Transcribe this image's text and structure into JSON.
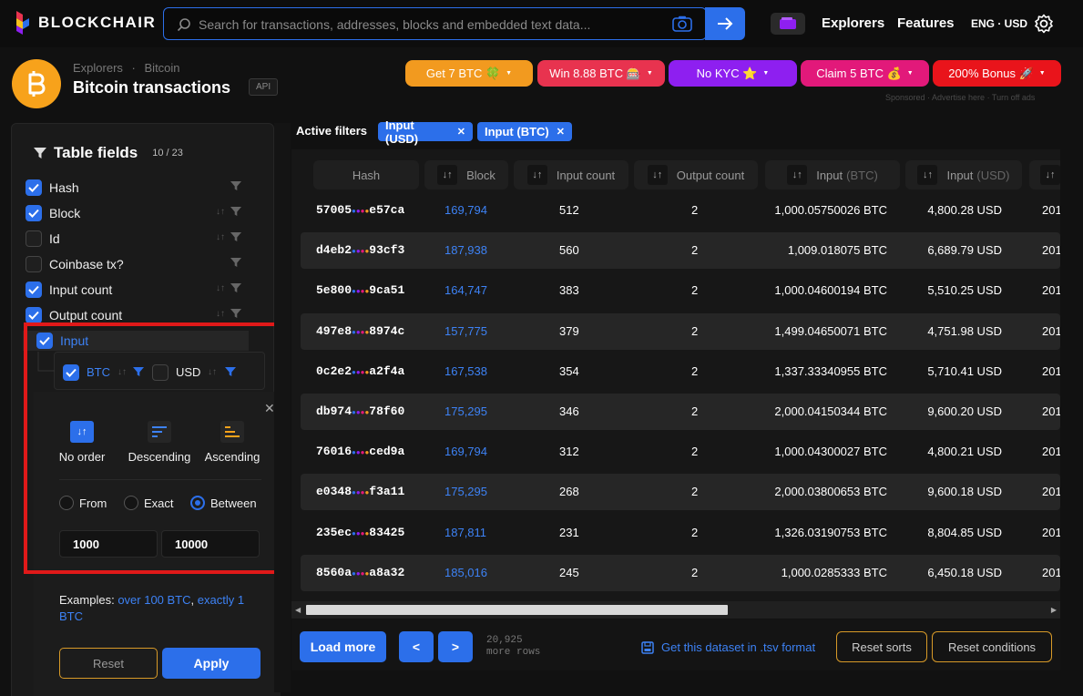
{
  "header": {
    "brand": "BLOCKCHAIR",
    "search_placeholder": "Search for transactions, addresses, blocks and embedded text data...",
    "nav": [
      "Explorers",
      "Features"
    ],
    "lang_currency": "ENG · USD"
  },
  "title": {
    "breadcrumb": [
      "Explorers",
      "Bitcoin"
    ],
    "page_title": "Bitcoin transactions",
    "api_badge": "API"
  },
  "promos": [
    {
      "label": "Get 7 BTC 🍀",
      "color": "#f29a1f"
    },
    {
      "label": "Win 8.88 BTC 🎰",
      "color": "#e8334f"
    },
    {
      "label": "No KYC ⭐",
      "color": "#8e1ff0"
    },
    {
      "label": "Claim 5 BTC 💰",
      "color": "#e2197a"
    },
    {
      "label": "200% Bonus 🚀",
      "color": "#e9141b"
    }
  ],
  "sponsored": "Sponsored · Advertise here · Turn off ads",
  "sidebar": {
    "title": "Table fields",
    "count": "10 / 23",
    "fields": [
      {
        "name": "Hash",
        "checked": true,
        "sort": false
      },
      {
        "name": "Block",
        "checked": true,
        "sort": true
      },
      {
        "name": "Id",
        "checked": false,
        "sort": true
      },
      {
        "name": "Coinbase tx?",
        "checked": false,
        "sort": false
      },
      {
        "name": "Input count",
        "checked": true,
        "sort": true
      },
      {
        "name": "Output count",
        "checked": true,
        "sort": true
      },
      {
        "name": "Input",
        "checked": true,
        "sort": false
      }
    ],
    "subfields": [
      {
        "name": "BTC",
        "checked": true
      },
      {
        "name": "USD",
        "checked": false
      }
    ],
    "order_options": [
      "No order",
      "Descending",
      "Ascending"
    ],
    "range_options": [
      "From",
      "Exact",
      "Between"
    ],
    "range_selected": "Between",
    "range_from": "1000",
    "range_to": "10000",
    "examples_prefix": "Examples: ",
    "example_1": "over 100 BTC",
    "example_sep": ", ",
    "example_2": "exactly 1 BTC",
    "reset_label": "Reset",
    "apply_label": "Apply"
  },
  "filters": {
    "label": "Active filters",
    "chips": [
      "Input (USD)",
      "Input (BTC)"
    ]
  },
  "table": {
    "columns": [
      "Hash",
      "Block",
      "Input count",
      "Output count",
      "Input",
      "(BTC)",
      "Input",
      "(USD)"
    ],
    "rows": [
      {
        "hash_a": "57005",
        "hash_b": "e57ca",
        "block": "169,794",
        "in_count": "512",
        "out_count": "2",
        "in_btc": "1,000.05750026 BTC",
        "in_usd": "4,800.28 USD",
        "date": "201"
      },
      {
        "hash_a": "d4eb2",
        "hash_b": "93cf3",
        "block": "187,938",
        "in_count": "560",
        "out_count": "2",
        "in_btc": "1,009.018075 BTC",
        "in_usd": "6,689.79 USD",
        "date": "201"
      },
      {
        "hash_a": "5e800",
        "hash_b": "9ca51",
        "block": "164,747",
        "in_count": "383",
        "out_count": "2",
        "in_btc": "1,000.04600194 BTC",
        "in_usd": "5,510.25 USD",
        "date": "201"
      },
      {
        "hash_a": "497e8",
        "hash_b": "8974c",
        "block": "157,775",
        "in_count": "379",
        "out_count": "2",
        "in_btc": "1,499.04650071 BTC",
        "in_usd": "4,751.98 USD",
        "date": "201"
      },
      {
        "hash_a": "0c2e2",
        "hash_b": "a2f4a",
        "block": "167,538",
        "in_count": "354",
        "out_count": "2",
        "in_btc": "1,337.33340955 BTC",
        "in_usd": "5,710.41 USD",
        "date": "201"
      },
      {
        "hash_a": "db974",
        "hash_b": "78f60",
        "block": "175,295",
        "in_count": "346",
        "out_count": "2",
        "in_btc": "2,000.04150344 BTC",
        "in_usd": "9,600.20 USD",
        "date": "201"
      },
      {
        "hash_a": "76016",
        "hash_b": "ced9a",
        "block": "169,794",
        "in_count": "312",
        "out_count": "2",
        "in_btc": "1,000.04300027 BTC",
        "in_usd": "4,800.21 USD",
        "date": "201"
      },
      {
        "hash_a": "e0348",
        "hash_b": "f3a11",
        "block": "175,295",
        "in_count": "268",
        "out_count": "2",
        "in_btc": "2,000.03800653 BTC",
        "in_usd": "9,600.18 USD",
        "date": "201"
      },
      {
        "hash_a": "235ec",
        "hash_b": "83425",
        "block": "187,811",
        "in_count": "231",
        "out_count": "2",
        "in_btc": "1,326.03190753 BTC",
        "in_usd": "8,804.85 USD",
        "date": "201"
      },
      {
        "hash_a": "8560a",
        "hash_b": "a8a32",
        "block": "185,016",
        "in_count": "245",
        "out_count": "2",
        "in_btc": "1,000.0285333 BTC",
        "in_usd": "6,450.18 USD",
        "date": "201"
      }
    ]
  },
  "footer": {
    "load_more": "Load more",
    "prev": "<",
    "next": ">",
    "rows_count": "20,925",
    "rows_suffix": "more rows",
    "tsv_link": "Get this dataset in .tsv format",
    "reset_sorts": "Reset sorts",
    "reset_conditions": "Reset conditions"
  },
  "colors": {
    "accent": "#2c6fea",
    "link": "#3d82f5",
    "outline": "#d89a28",
    "highlight": "#e01919"
  }
}
